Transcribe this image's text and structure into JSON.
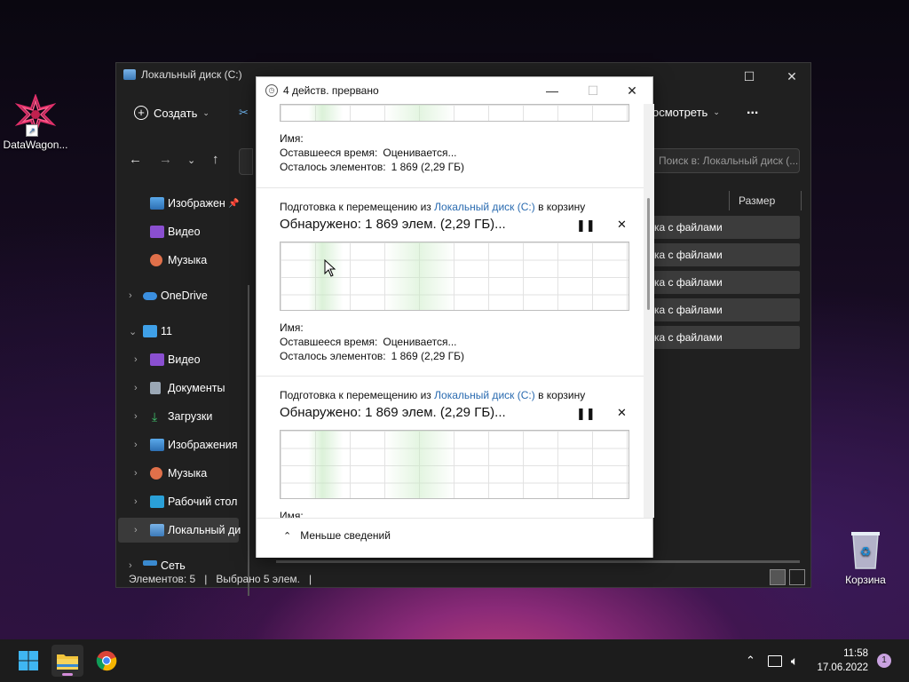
{
  "desktop": {
    "icons": [
      {
        "label": "DataWagon..."
      },
      {
        "label": "Корзина"
      }
    ]
  },
  "explorer": {
    "title": "Локальный диск (C:)",
    "toolbar": {
      "create_label": "Создать",
      "view_label": "осмотреть",
      "more_label": "..."
    },
    "search_placeholder": "Поиск в: Локальный диск (...",
    "sidebar": [
      {
        "label": "Изображен",
        "pinned": true
      },
      {
        "label": "Видео"
      },
      {
        "label": "Музыка"
      },
      {
        "label": "OneDrive"
      },
      {
        "label": "11"
      },
      {
        "label": "Видео"
      },
      {
        "label": "Документы"
      },
      {
        "label": "Загрузки"
      },
      {
        "label": "Изображения"
      },
      {
        "label": "Музыка"
      },
      {
        "label": "Рабочий стол"
      },
      {
        "label": "Локальный ди"
      },
      {
        "label": "Сеть"
      }
    ],
    "column_size": "Размер",
    "rows": [
      "ка с файлами",
      "ка с файлами",
      "ка с файлами",
      "ка с файлами",
      "ка с файлами"
    ],
    "status": {
      "items": "Элементов: 5",
      "selected": "Выбрано 5 элем.",
      "sep": "|"
    }
  },
  "dialog": {
    "title": "4 действ. прервано",
    "operations": [
      {
        "detail_name": "Имя:",
        "detail_time_label": "Оставшееся время:",
        "detail_time_value": "Оценивается...",
        "detail_left_label": "Осталось элементов:",
        "detail_left_value": "1 869 (2,29 ГБ)"
      },
      {
        "head_prefix": "Подготовка к перемещению из",
        "head_link": "Локальный диск (C:)",
        "head_suffix": "в корзину",
        "found": "Обнаружено: 1 869 элем. (2,29 ГБ)...",
        "detail_name": "Имя:",
        "detail_time_label": "Оставшееся время:",
        "detail_time_value": "Оценивается...",
        "detail_left_label": "Осталось элементов:",
        "detail_left_value": "1 869 (2,29 ГБ)"
      },
      {
        "head_prefix": "Подготовка к перемещению из",
        "head_link": "Локальный диск (C:)",
        "head_suffix": "в корзину",
        "found": "Обнаружено: 1 869 элем. (2,29 ГБ)...",
        "detail_name": "Имя:"
      }
    ],
    "footer_label": "Меньше сведений"
  },
  "taskbar": {
    "time": "11:58",
    "date": "17.06.2022",
    "notifications": "1"
  }
}
